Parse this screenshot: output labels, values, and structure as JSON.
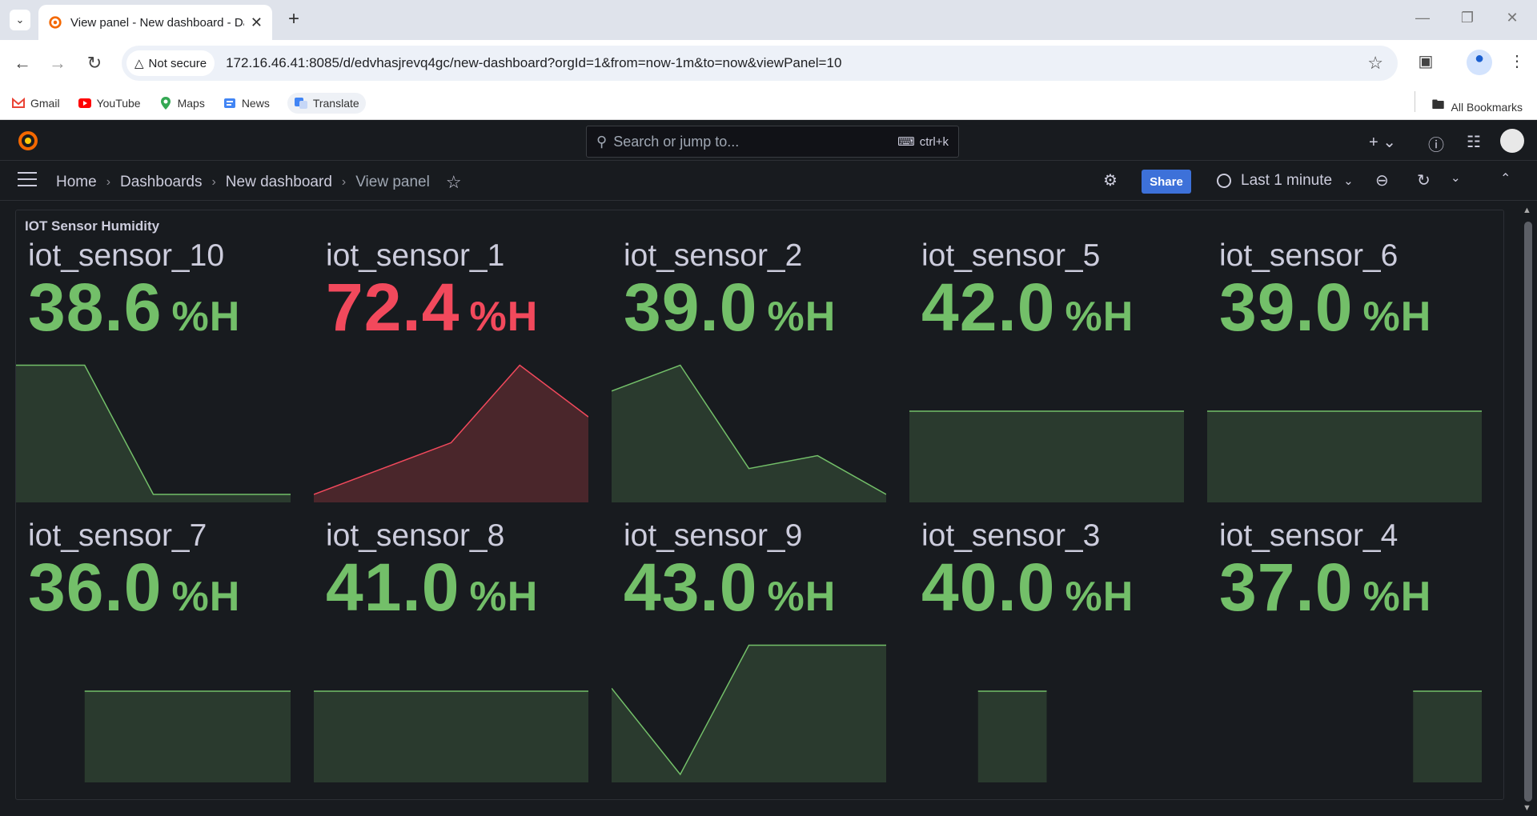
{
  "browser": {
    "tab_title": "View panel - New dashboard - Dashboards - Grafana",
    "security_label": "Not secure",
    "url": "172.16.46.41:8085/d/edvhasjrevq4gc/new-dashboard?orgId=1&from=now-1m&to=now&viewPanel=10",
    "bookmarks": [
      "Gmail",
      "YouTube",
      "Maps",
      "News",
      "Translate"
    ],
    "all_bookmarks": "All Bookmarks"
  },
  "grafana": {
    "search_placeholder": "Search or jump to...",
    "search_shortcut": "ctrl+k",
    "breadcrumbs": [
      "Home",
      "Dashboards",
      "New dashboard",
      "View panel"
    ],
    "share_label": "Share",
    "time_range": "Last 1 minute"
  },
  "panel": {
    "title": "IOT Sensor Humidity",
    "colors": {
      "green": "#73bf69",
      "green_fill": "#2a3a2e",
      "red": "#f2495c",
      "red_fill": "#4a262b"
    },
    "cells": [
      {
        "name": "iot_sensor_10",
        "value": "38.6",
        "unit": "%H",
        "status": "green",
        "spark": [
          38.7,
          38.7,
          38.6,
          38.6,
          38.6
        ]
      },
      {
        "name": "iot_sensor_1",
        "value": "72.4",
        "unit": "%H",
        "status": "red",
        "spark": [
          71.5,
          71.8,
          72.1,
          73.0,
          72.4
        ]
      },
      {
        "name": "iot_sensor_2",
        "value": "39.0",
        "unit": "%H",
        "status": "green",
        "spark": [
          43.0,
          44.0,
          40.0,
          40.5,
          39.0
        ]
      },
      {
        "name": "iot_sensor_5",
        "value": "42.0",
        "unit": "%H",
        "status": "green",
        "spark": [
          42.0,
          42.0,
          42.0,
          42.0,
          42.0
        ]
      },
      {
        "name": "iot_sensor_6",
        "value": "39.0",
        "unit": "%H",
        "status": "green",
        "spark": [
          39.0,
          39.0,
          39.0,
          39.0,
          39.0
        ]
      },
      {
        "name": "iot_sensor_7",
        "value": "36.0",
        "unit": "%H",
        "status": "green",
        "spark": [
          null,
          36.0,
          36.0,
          36.0,
          36.0
        ]
      },
      {
        "name": "iot_sensor_8",
        "value": "41.0",
        "unit": "%H",
        "status": "green",
        "spark": [
          41.0,
          41.0,
          41.0,
          41.0,
          41.0
        ]
      },
      {
        "name": "iot_sensor_9",
        "value": "43.0",
        "unit": "%H",
        "status": "green",
        "spark": [
          42.0,
          40.0,
          43.0,
          43.0,
          43.0
        ]
      },
      {
        "name": "iot_sensor_3",
        "value": "40.0",
        "unit": "%H",
        "status": "green",
        "spark": [
          null,
          40.0,
          40.0,
          null,
          null
        ]
      },
      {
        "name": "iot_sensor_4",
        "value": "37.0",
        "unit": "%H",
        "status": "green",
        "spark": [
          null,
          null,
          null,
          37.0,
          37.0
        ]
      }
    ]
  }
}
